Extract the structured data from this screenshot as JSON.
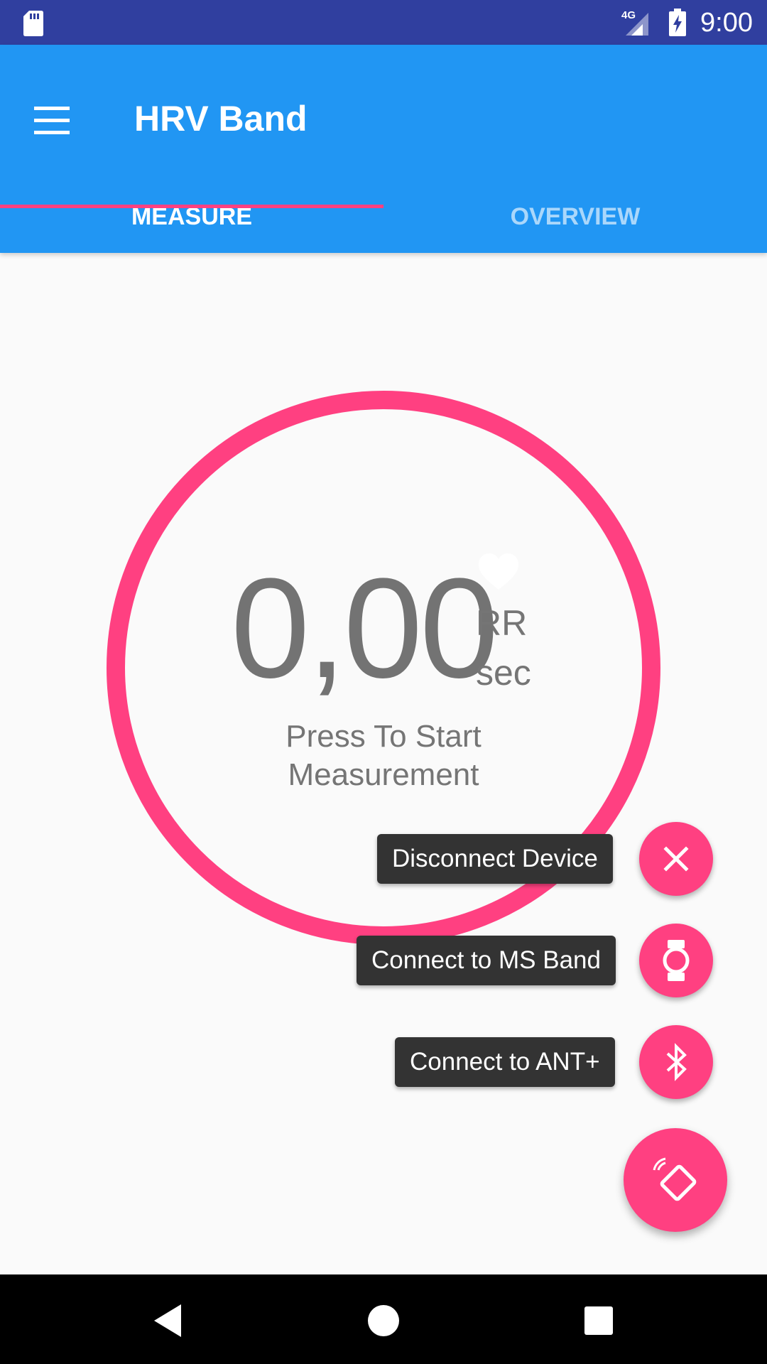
{
  "status_bar": {
    "time": "9:00",
    "network": "4G",
    "icons": [
      "sd-card-icon",
      "signal-icon",
      "battery-charging-icon"
    ]
  },
  "app_bar": {
    "title": "HRV Band",
    "menu_icon": "menu-icon"
  },
  "tabs": [
    {
      "label": "MEASURE",
      "selected": true
    },
    {
      "label": "OVERVIEW",
      "selected": false
    }
  ],
  "measure": {
    "value": "0,00",
    "unit_line1": "RR",
    "unit_line2": "sec",
    "hint_line1": "Press To Start",
    "hint_line2": "Measurement",
    "heart_icon": "heart-icon"
  },
  "fab_menu": {
    "items": [
      {
        "label": "Disconnect Device",
        "icon": "close-icon"
      },
      {
        "label": "Connect to MS Band",
        "icon": "watch-icon"
      },
      {
        "label": "Connect to ANT+",
        "icon": "bluetooth-icon"
      }
    ],
    "main_icon": "device-connect-icon"
  },
  "nav_bar": {
    "icons": [
      "back-icon",
      "home-icon",
      "recents-icon"
    ]
  },
  "colors": {
    "primary": "#2196f3",
    "primary_dark": "#303f9f",
    "accent": "#ff4081",
    "text_secondary": "#757575"
  }
}
